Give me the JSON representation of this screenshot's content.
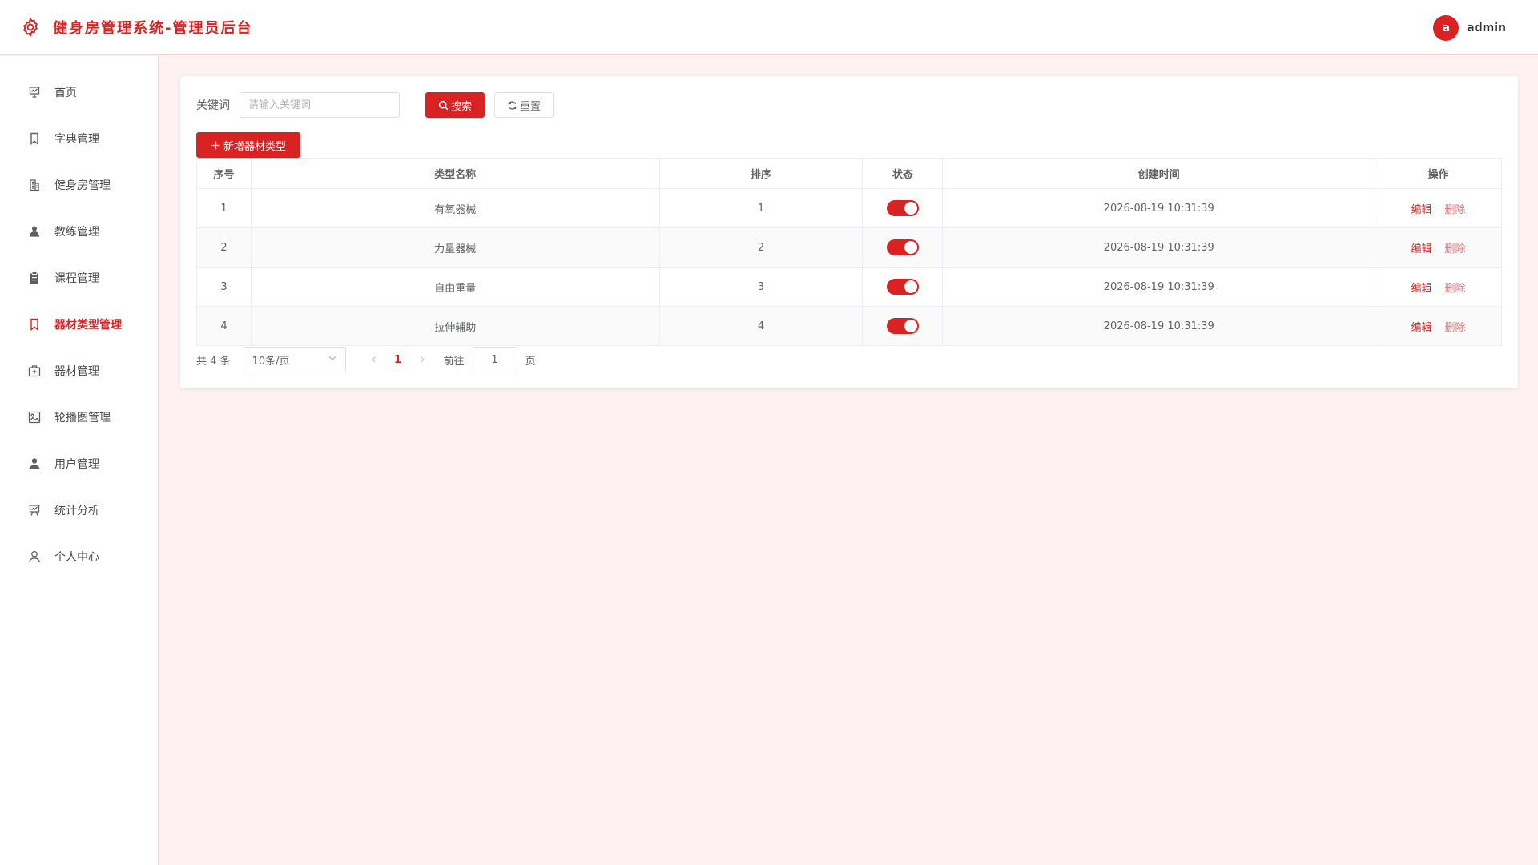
{
  "header": {
    "title": "健身房管理系统-管理员后台",
    "user": {
      "avatar_letter": "a",
      "name": "admin"
    }
  },
  "sidebar": {
    "items": [
      {
        "label": "首页",
        "icon": "dashboard-icon",
        "active": false
      },
      {
        "label": "字典管理",
        "icon": "bookmark-icon",
        "active": false
      },
      {
        "label": "健身房管理",
        "icon": "building-icon",
        "active": false
      },
      {
        "label": "教练管理",
        "icon": "user-stamp-icon",
        "active": false
      },
      {
        "label": "课程管理",
        "icon": "clipboard-icon",
        "active": false
      },
      {
        "label": "器材类型管理",
        "icon": "bookmark-icon",
        "active": true
      },
      {
        "label": "器材管理",
        "icon": "first-aid-kit-icon",
        "active": false
      },
      {
        "label": "轮播图管理",
        "icon": "picture-icon",
        "active": false
      },
      {
        "label": "用户管理",
        "icon": "user-icon",
        "active": false
      },
      {
        "label": "统计分析",
        "icon": "presentation-chart-icon",
        "active": false
      },
      {
        "label": "个人中心",
        "icon": "person-outline-icon",
        "active": false
      }
    ]
  },
  "filter": {
    "label": "关键词",
    "placeholder": "请输入关键词",
    "search_label": "搜索",
    "reset_label": "重置"
  },
  "toolbar": {
    "add_label": "新增器材类型"
  },
  "table": {
    "columns": [
      "序号",
      "类型名称",
      "排序",
      "状态",
      "创建时间",
      "操作"
    ],
    "rows": [
      {
        "index": "1",
        "name": "有氧器械",
        "sort": "1",
        "enabled": true,
        "created": "2026-08-19 10:31:39"
      },
      {
        "index": "2",
        "name": "力量器械",
        "sort": "2",
        "enabled": true,
        "created": "2026-08-19 10:31:39"
      },
      {
        "index": "3",
        "name": "自由重量",
        "sort": "3",
        "enabled": true,
        "created": "2026-08-19 10:31:39"
      },
      {
        "index": "4",
        "name": "拉伸辅助",
        "sort": "4",
        "enabled": true,
        "created": "2026-08-19 10:31:39"
      }
    ],
    "edit_label": "编辑",
    "delete_label": "删除"
  },
  "pagination": {
    "total_text": "共 4 条",
    "page_size": "10条/页",
    "current_page": "1",
    "goto_label": "前往",
    "goto_value": "1",
    "page_suffix": "页"
  },
  "colors": {
    "accent": "#d92323",
    "background": "#fdf1f1",
    "delete_text": "#e87878"
  }
}
